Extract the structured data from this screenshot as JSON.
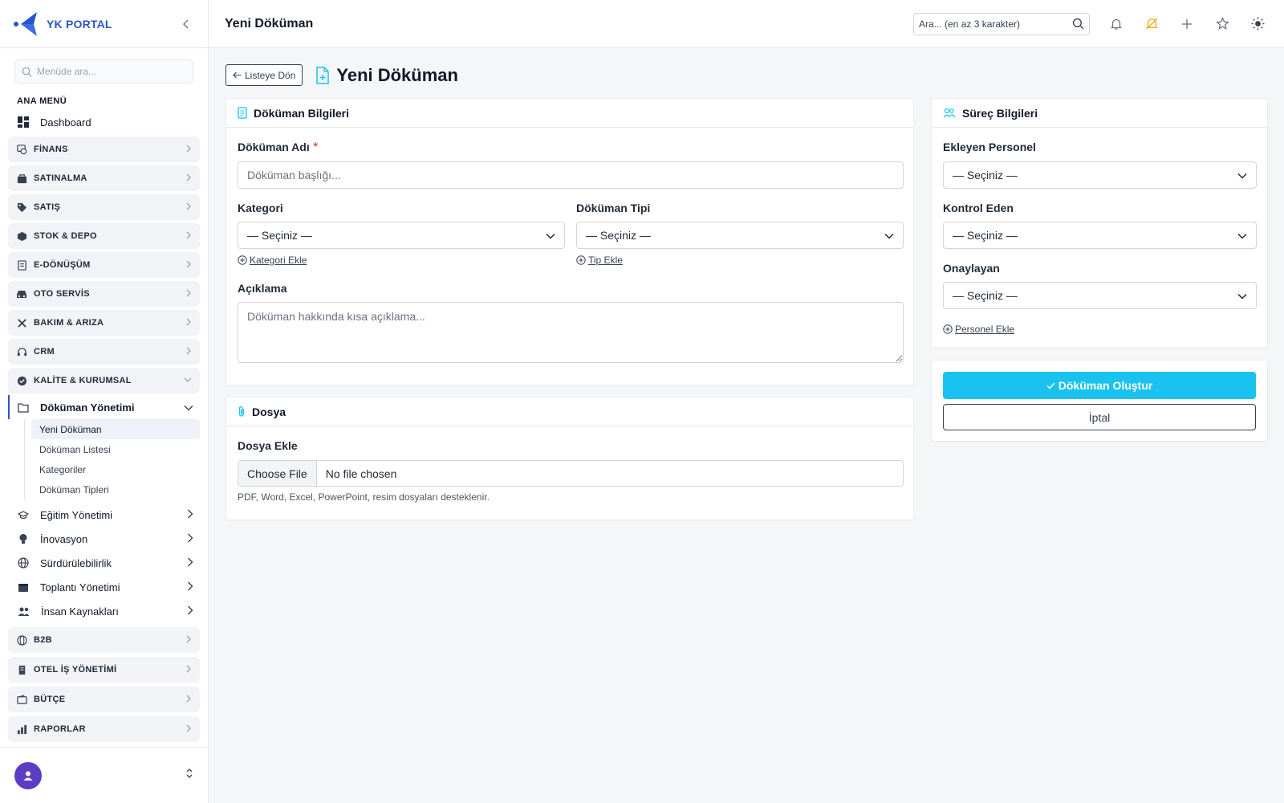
{
  "brand": {
    "name": "YK PORTAL"
  },
  "sidebar": {
    "search_placeholder": "Menüde ara...",
    "section_label": "ANA MENÜ",
    "dashboard": "Dashboard",
    "groups_top": [
      "FİNANS",
      "SATINALMA",
      "SATIŞ",
      "STOK & DEPO",
      "E-DÖNÜŞÜM",
      "OTO SERVİS",
      "BAKIM & ARIZA",
      "CRM",
      "KALİTE & KURUMSAL"
    ],
    "open_sub": "Döküman Yönetimi",
    "leaves": [
      "Yeni Döküman",
      "Döküman Listesi",
      "Kategoriler",
      "Döküman Tipleri"
    ],
    "subs": [
      "Eğitim Yönetimi",
      "İnovasyon",
      "Sürdürülebilirlik",
      "Toplantı Yönetimi",
      "İnsan Kaynakları"
    ],
    "groups_bottom": [
      "B2B",
      "OTEL İŞ YÖNETİMİ",
      "BÜTÇE",
      "RAPORLAR"
    ]
  },
  "topbar": {
    "title": "Yeni Döküman",
    "search_placeholder": "Ara... (en az 3 karakter)"
  },
  "page": {
    "back_label": "Listeye Dön",
    "title": "Yeni Döküman"
  },
  "doc_card": {
    "title": "Döküman Bilgileri",
    "name_label": "Döküman Adı",
    "required_mark": "*",
    "name_placeholder": "Döküman başlığı...",
    "category_label": "Kategori",
    "category_value": "— Seçiniz —",
    "category_add": "Kategori Ekle",
    "type_label": "Döküman Tipi",
    "type_value": "— Seçiniz —",
    "type_add": "Tip Ekle",
    "desc_label": "Açıklama",
    "desc_placeholder": "Döküman hakkında kısa açıklama..."
  },
  "file_card": {
    "title": "Dosya",
    "label": "Dosya Ekle",
    "button": "Choose File",
    "status": "No file chosen",
    "help": "PDF, Word, Excel, PowerPoint, resim dosyaları desteklenir."
  },
  "process_card": {
    "title": "Süreç Bilgileri",
    "adder_label": "Ekleyen Personel",
    "adder_value": "— Seçiniz —",
    "controller_label": "Kontrol Eden",
    "controller_value": "— Seçiniz —",
    "approver_label": "Onaylayan",
    "approver_value": "— Seçiniz —",
    "add_personnel": "Personel Ekle"
  },
  "actions": {
    "create": "Döküman Oluştur",
    "cancel": "İptal"
  },
  "colors": {
    "brand": "#2b54c9",
    "primary": "#19c2ef",
    "warning_icon": "#f2b01e"
  }
}
